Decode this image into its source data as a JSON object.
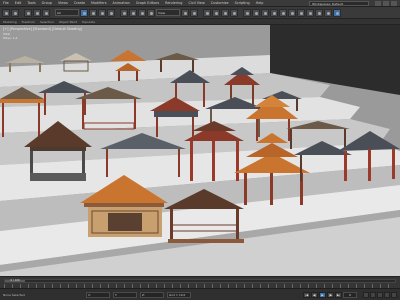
{
  "app": {
    "menus": [
      "File",
      "Edit",
      "Tools",
      "Group",
      "Views",
      "Create",
      "Modifiers",
      "Animation",
      "Graph Editors",
      "Rendering",
      "Civil View",
      "Customize",
      "Scripting",
      "Help"
    ],
    "workspace": "Workspaces: Default"
  },
  "toolbar": {
    "selection_filter": "All",
    "coord_system": "View"
  },
  "ribbon": {
    "tabs": [
      "Modeling",
      "Freeform",
      "Selection",
      "Object Paint",
      "Populate"
    ]
  },
  "viewport": {
    "label": "[+] [Perspective] [Standard] [Default Shading]",
    "stats_line1": "Total",
    "stats_line2": "Polys: 1,2"
  },
  "timeline": {
    "position": "0 / 100"
  },
  "status": {
    "message": "None Selected",
    "x_label": "X:",
    "y_label": "Y:",
    "z_label": "Z:",
    "grid": "Grid = 10.0",
    "frame": "0",
    "buttons": {
      "start": "|◀",
      "prev": "◀|",
      "play": "▶",
      "next": "|▶",
      "end": "▶|"
    }
  },
  "colors": {
    "ui_bg": "#3a3a3a",
    "viewport_bg": "#8a8a8a",
    "accent": "#3d6fa8",
    "roof_dark": "#4a4f57",
    "roof_orange": "#c9752f",
    "wood_red": "#8b3a2a"
  }
}
